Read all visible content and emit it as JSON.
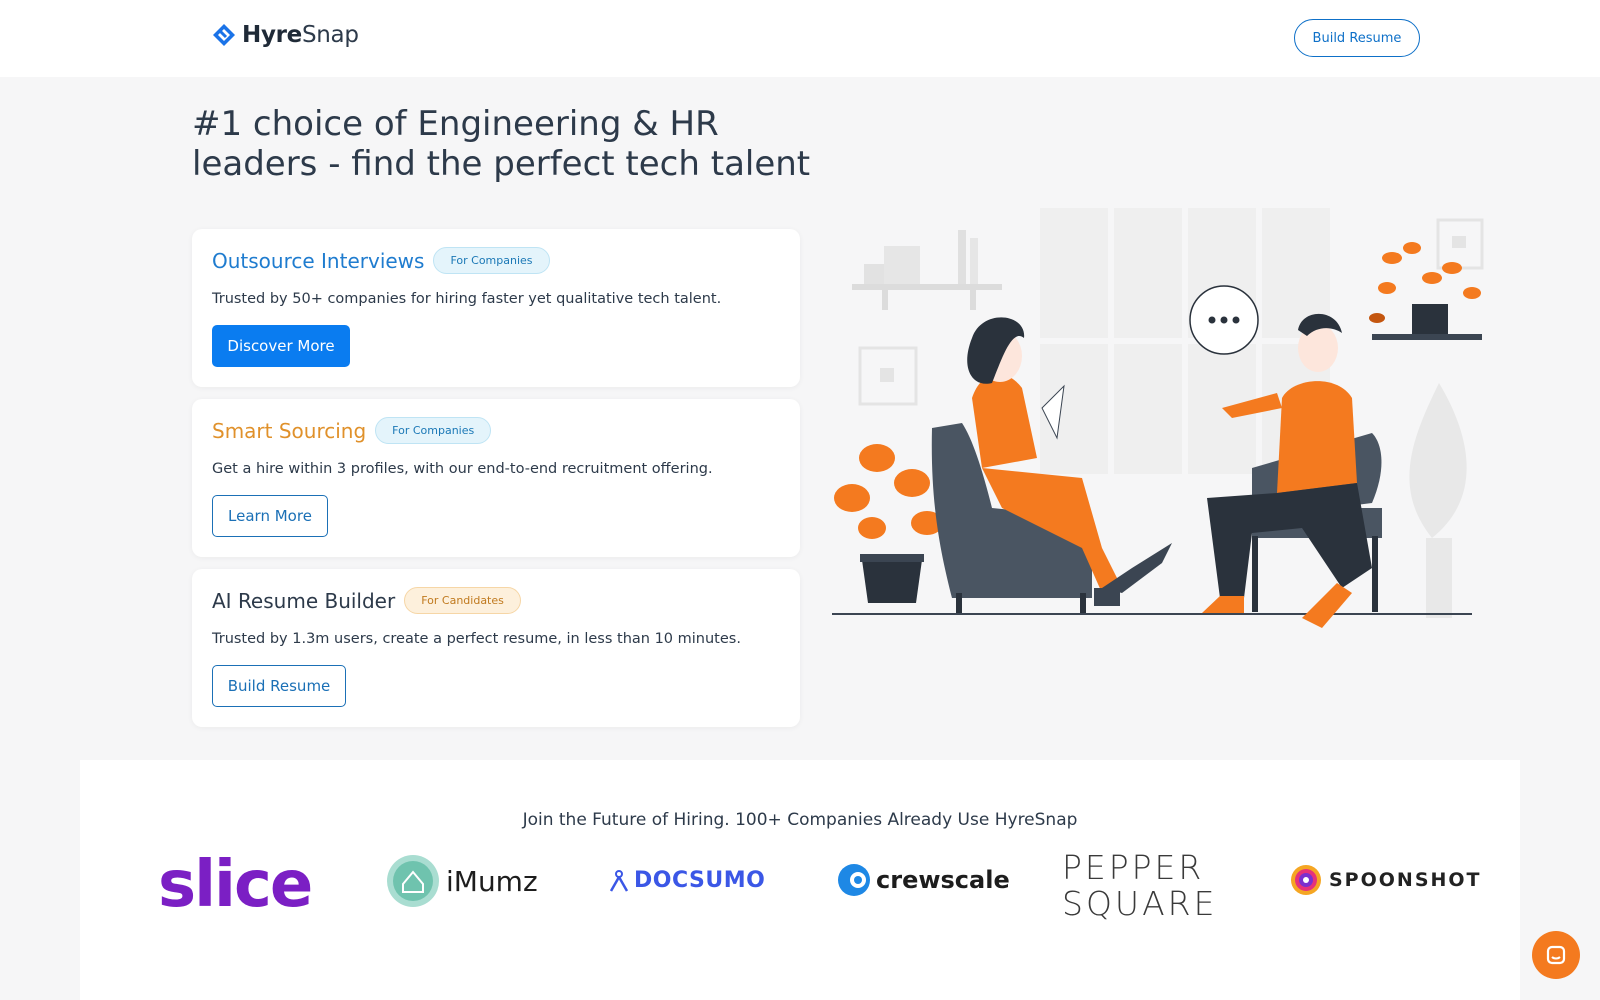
{
  "brand": {
    "name_bold": "Hyre",
    "name_light": "Snap",
    "color": "#1a73e8"
  },
  "nav": {
    "cta_label": "Build Resume"
  },
  "hero": {
    "title_line1": "#1 choice of Engineering & HR",
    "title_line2": "leaders - find the perfect tech talent"
  },
  "cards": [
    {
      "title": "Outsource Interviews",
      "title_color": "#1f7ccf",
      "tag": "For Companies",
      "description": "Trusted by 50+ companies for hiring faster yet qualitative tech talent.",
      "button": "Discover More",
      "button_style": "solid"
    },
    {
      "title": "Smart Sourcing",
      "title_color": "#e0912b",
      "tag": "For Companies",
      "description": "Get a hire within 3 profiles, with our end-to-end recruitment offering.",
      "button": "Learn More",
      "button_style": "outline"
    },
    {
      "title": "AI Resume Builder",
      "title_color": "#2d3a4a",
      "tag": "For Candidates",
      "description": "Trusted by 1.3m users, create a perfect resume, in less than 10 minutes.",
      "button": "Build Resume",
      "button_style": "outline"
    }
  ],
  "companies": {
    "tagline": "Join the Future of Hiring. 100+ Companies Already Use HyreSnap",
    "logos": [
      {
        "name": "slice",
        "color": "#7b1fc4"
      },
      {
        "name": "iMumz",
        "color": "#1d1d1d"
      },
      {
        "name": "DOCSUMO",
        "color": "#3b57e6"
      },
      {
        "name": "crewscale",
        "color": "#1d1d1d"
      },
      {
        "name_line1": "PEPPER",
        "name_line2": "SQUARE",
        "color": "#3a3a3a"
      },
      {
        "name": "SPOONSHOT",
        "color": "#222222"
      }
    ]
  },
  "colors": {
    "accent": "#0a7cf0",
    "orange": "#f47a1f",
    "background": "#f6f6f7"
  },
  "chat": {
    "icon": "chat-icon"
  }
}
